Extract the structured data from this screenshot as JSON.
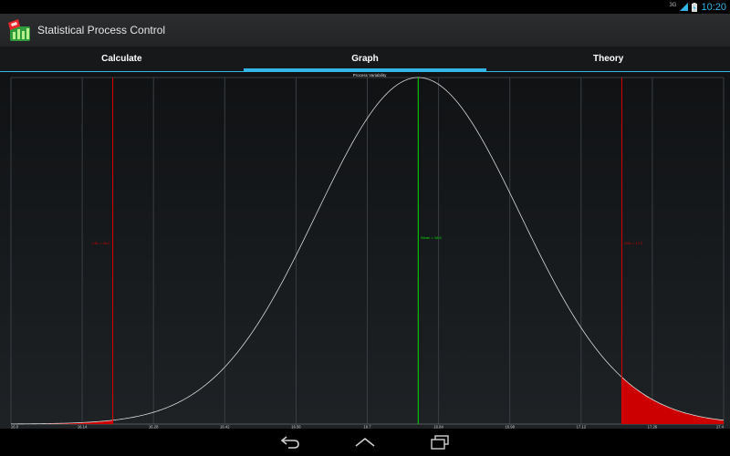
{
  "status_bar": {
    "network": "3G",
    "time": "10:20"
  },
  "app": {
    "title": "Statistical Process Control",
    "icon": "spc-app-icon"
  },
  "tabs": [
    {
      "label": "Calculate",
      "selected": false
    },
    {
      "label": "Graph",
      "selected": true
    },
    {
      "label": "Theory",
      "selected": false
    }
  ],
  "chart_data": {
    "type": "line",
    "title": "Process Variability",
    "x_ticks": [
      "16.0",
      "16.14",
      "16.28",
      "16.42",
      "16.56",
      "16.7",
      "16.84",
      "16.98",
      "17.12",
      "17.26",
      "17.4"
    ],
    "xlim": [
      16.0,
      17.4
    ],
    "mean": 16.8,
    "std_dev": 0.2,
    "lsl": 16.2,
    "usl": 17.2,
    "annotations": {
      "lsl": "LSL = 16.2",
      "mean": "Mean = 16.8",
      "usl": "USL = 17.2"
    },
    "grid": true,
    "colors": {
      "curve": "#d8d8d8",
      "mean": "#00e000",
      "limits": "#dd0000",
      "tail_fill": "#cc0000",
      "grid": "#3a3e42"
    }
  },
  "nav": {
    "back": "back-icon",
    "home": "home-icon",
    "recents": "recents-icon"
  }
}
